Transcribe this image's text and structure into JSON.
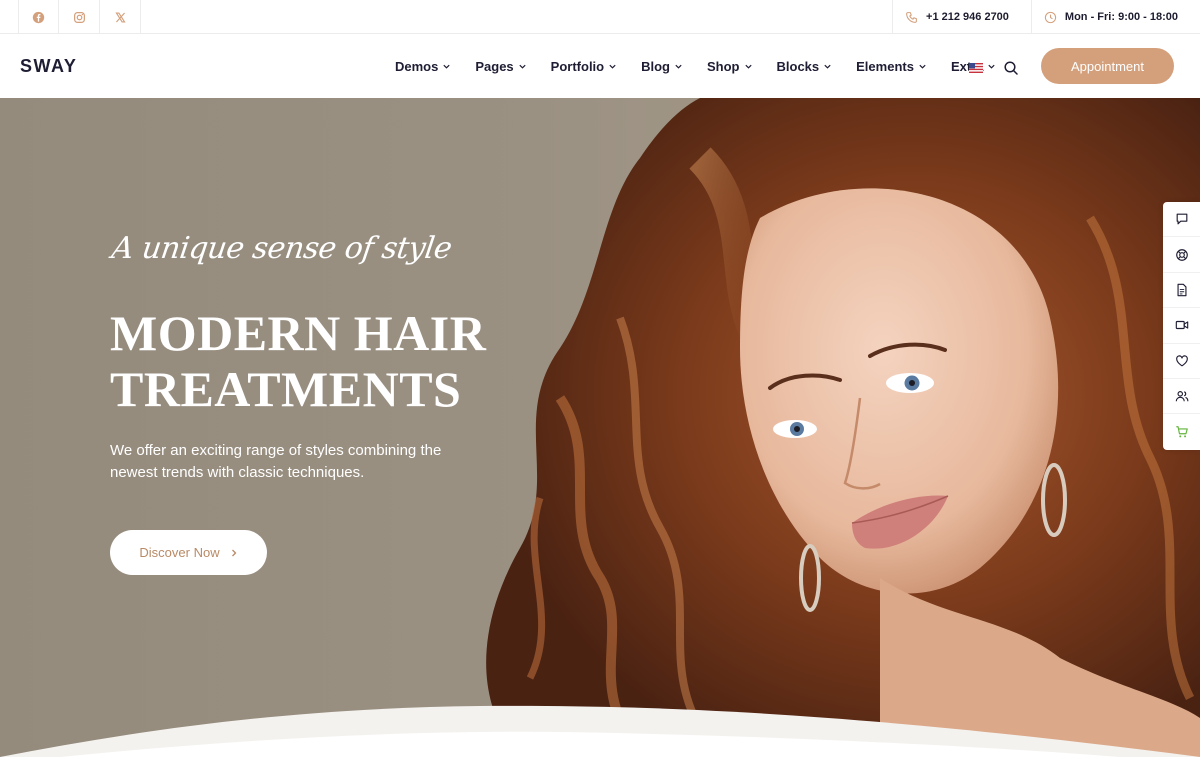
{
  "topbar": {
    "social": [
      {
        "icon": "facebook-icon"
      },
      {
        "icon": "instagram-icon"
      },
      {
        "icon": "x-twitter-icon"
      }
    ],
    "phone": "+1 212 946 2700",
    "hours": "Mon - Fri: 9:00 - 18:00"
  },
  "header": {
    "logo": "SWAY",
    "nav": [
      "Demos",
      "Pages",
      "Portfolio",
      "Blog",
      "Shop",
      "Blocks",
      "Elements",
      "Extra"
    ],
    "cta": "Appointment"
  },
  "hero": {
    "script_line": "A unique sense of style",
    "title_line1": "MODERN HAIR",
    "title_line2": "TREATMENTS",
    "description": "We offer an exciting range of styles combining the newest trends with classic techniques.",
    "button": "Discover Now"
  },
  "side_toolbar": [
    "chat-icon",
    "support-icon",
    "document-icon",
    "video-icon",
    "heart-icon",
    "users-icon",
    "cart-icon"
  ],
  "colors": {
    "accent": "#d4a07c",
    "brand_text": "#1e1d33",
    "hero_bg": "#9b9183",
    "cart_green": "#62b43a"
  }
}
